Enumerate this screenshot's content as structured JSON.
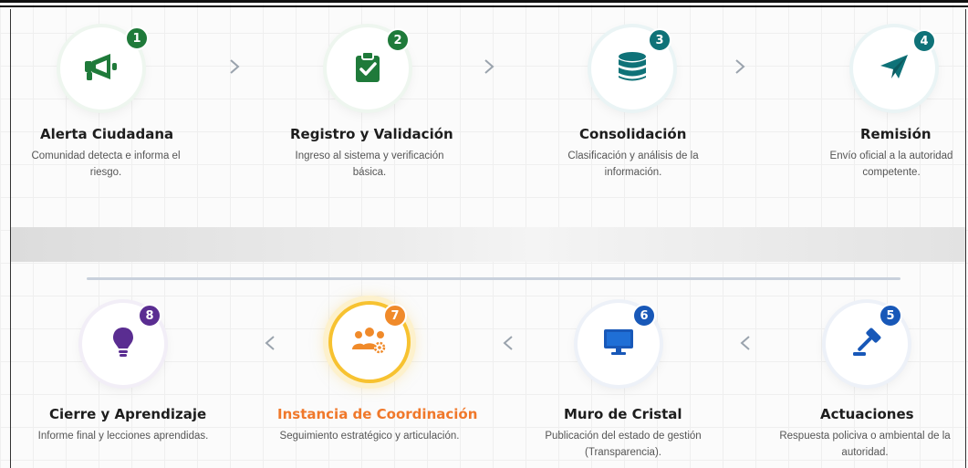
{
  "process_steps": {
    "top_row": [
      {
        "number": "1",
        "title": "Alerta Ciudadana",
        "description": "Comunidad detecta e informa el riesgo.",
        "icon": "megaphone-icon",
        "color": "#1f7a3a",
        "badge_color": "#1f7a3a"
      },
      {
        "number": "2",
        "title": "Registro y Validación",
        "description": "Ingreso al sistema y verificación básica.",
        "icon": "clipboard-check-icon",
        "color": "#1f7a3a",
        "badge_color": "#1f7a3a"
      },
      {
        "number": "3",
        "title": "Consolidación",
        "description": "Clasificación y análisis de la información.",
        "icon": "database-icon",
        "color": "#0f7278",
        "badge_color": "#0f7278"
      },
      {
        "number": "4",
        "title": "Remisión",
        "description": "Envío oficial a la autoridad competente.",
        "icon": "paper-plane-icon",
        "color": "#0f7278",
        "badge_color": "#0f7278"
      }
    ],
    "bottom_row": [
      {
        "number": "8",
        "title": "Cierre y Aprendizaje",
        "description": "Informe final y lecciones aprendidas.",
        "icon": "lightbulb-icon",
        "color": "#5a2d91",
        "badge_color": "#5a2d91"
      },
      {
        "number": "7",
        "title": "Instancia de Coordinación",
        "description": "Seguimiento estratégico y articulación.",
        "icon": "team-gear-icon",
        "color": "#f08a2a",
        "badge_color": "#f08a2a",
        "active": true
      },
      {
        "number": "6",
        "title": "Muro de Cristal",
        "description": "Publicación del estado de gestión (Transparencia).",
        "icon": "monitor-icon",
        "color": "#1858b8",
        "badge_color": "#1858b8"
      },
      {
        "number": "5",
        "title": "Actuaciones",
        "description": "Respuesta policiva o ambiental de la autoridad.",
        "icon": "gavel-icon",
        "color": "#1858b8",
        "badge_color": "#1858b8"
      }
    ]
  },
  "colors": {
    "active_title": "#f0782a",
    "active_ring": "#f7c230",
    "chevron": "#9aa3ad"
  }
}
